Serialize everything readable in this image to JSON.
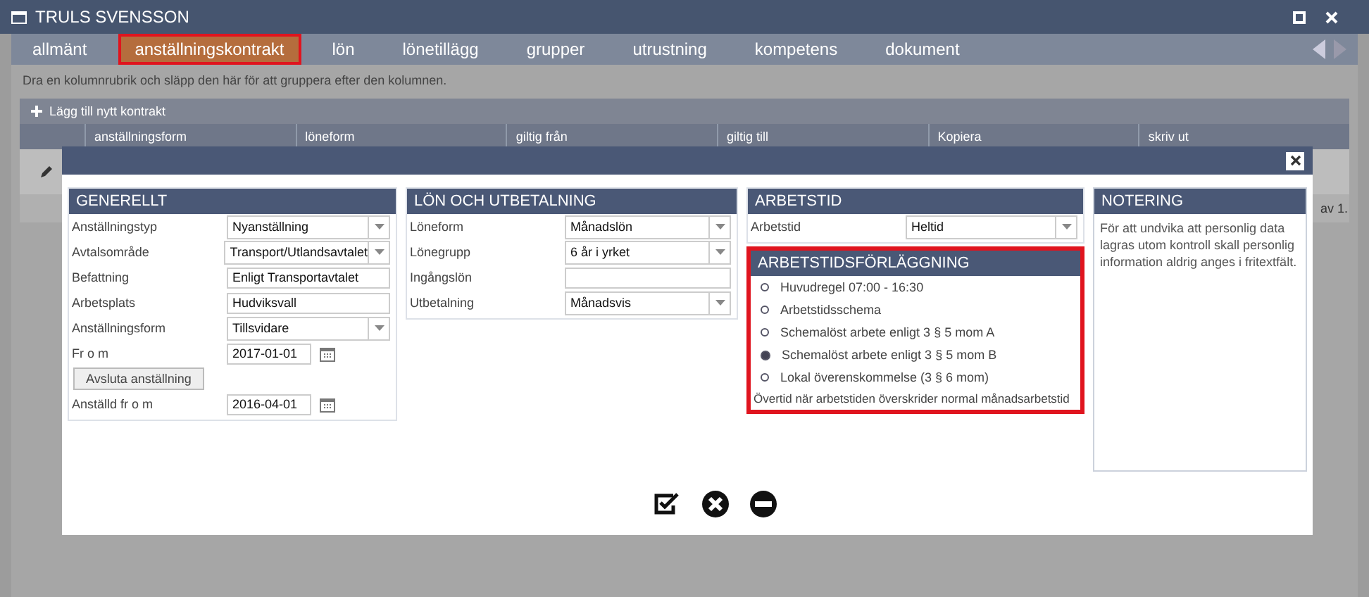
{
  "window": {
    "title": "TRULS SVENSSON"
  },
  "tabs": [
    {
      "label": "allmänt",
      "selected": false,
      "highlighted": false
    },
    {
      "label": "anställningskontrakt",
      "selected": true,
      "highlighted": true
    },
    {
      "label": "lön",
      "selected": false,
      "highlighted": false
    },
    {
      "label": "lönetillägg",
      "selected": false,
      "highlighted": false
    },
    {
      "label": "grupper",
      "selected": false,
      "highlighted": false
    },
    {
      "label": "utrustning",
      "selected": false,
      "highlighted": false
    },
    {
      "label": "kompetens",
      "selected": false,
      "highlighted": false
    },
    {
      "label": "dokument",
      "selected": false,
      "highlighted": false
    }
  ],
  "grid": {
    "group_hint": "Dra en kolumnrubrik och släpp den här för att gruppera efter den kolumnen.",
    "add_button": "Lägg till nytt kontrakt",
    "columns": [
      "anställningsform",
      "löneform",
      "giltig från",
      "giltig till",
      "Kopiera",
      "skriv ut"
    ],
    "pager": "av 1."
  },
  "modal": {
    "sections": [
      {
        "title": "GENERELLT",
        "fields": [
          {
            "kind": "select",
            "label": "Anställningstyp",
            "value": "Nyanställning"
          },
          {
            "kind": "select",
            "label": "Avtalsområde",
            "value": "Transport/Utlandsavtalet"
          },
          {
            "kind": "text",
            "label": "Befattning",
            "value": "Enligt Transportavtalet"
          },
          {
            "kind": "text",
            "label": "Arbetsplats",
            "value": "Hudviksvall"
          },
          {
            "kind": "select",
            "label": "Anställningsform",
            "value": "Tillsvidare"
          },
          {
            "kind": "date",
            "label": "Fr o m",
            "value": "2017-01-01"
          },
          {
            "kind": "button",
            "label": "Avsluta anställning"
          },
          {
            "kind": "date",
            "label": "Anställd fr o m",
            "value": "2016-04-01"
          }
        ]
      },
      {
        "title": "LÖN OCH UTBETALNING",
        "fields": [
          {
            "kind": "select",
            "label": "Löneform",
            "value": "Månadslön"
          },
          {
            "kind": "select",
            "label": "Lönegrupp",
            "value": "6 år i yrket"
          },
          {
            "kind": "text",
            "label": "Ingångslön"
          },
          {
            "kind": "select",
            "label": "Utbetalning",
            "value": "Månadsvis"
          }
        ]
      },
      {
        "title": "ARBETSTID",
        "fields": [
          {
            "kind": "select",
            "label": "Arbetstid",
            "value": "Heltid"
          }
        ]
      }
    ],
    "schedule": {
      "title": "ARBETSTIDSFÖRLÄGGNING",
      "highlighted": true,
      "options": [
        {
          "label": "Huvudregel 07:00 - 16:30",
          "selected": false
        },
        {
          "label": "Arbetstidsschema",
          "selected": false
        },
        {
          "label": "Schemalöst arbete enligt 3 § 5 mom A",
          "selected": false
        },
        {
          "label": "Schemalöst arbete enligt 3 § 5 mom B",
          "selected": true
        },
        {
          "label": "Lokal överenskommelse (3 § 6 mom)",
          "selected": false
        }
      ],
      "note": "Övertid när arbetstiden överskrider normal månadsarbetstid"
    },
    "notes": {
      "title": "NOTERING",
      "text": "För att undvika att personlig data lagras utom kontroll skall personlig information aldrig anges i fritextfält."
    }
  }
}
